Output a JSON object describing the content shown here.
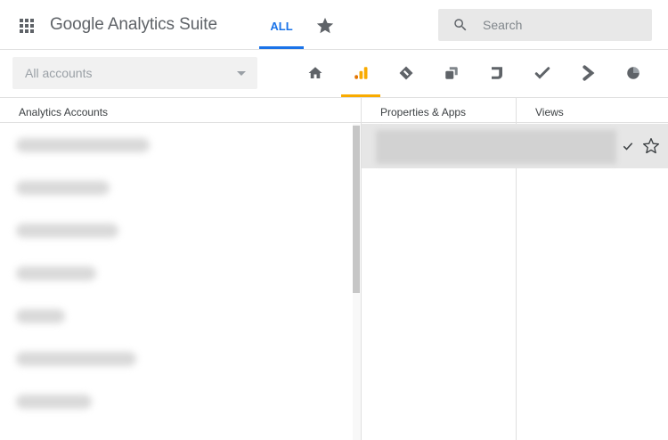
{
  "header": {
    "apps_icon": "apps-grid-icon",
    "brand_google": "Google",
    "brand_product": "Analytics Suite",
    "tabs": [
      {
        "label": "ALL",
        "active": true
      },
      {
        "icon": "star-icon",
        "active": false
      }
    ],
    "search": {
      "placeholder": "Search",
      "value": "",
      "icon": "search-icon"
    },
    "accent_color": "#1a73e8"
  },
  "toolbar": {
    "account_selector": {
      "value": "All accounts",
      "icon": "dropdown-caret-icon"
    },
    "product_tabs": [
      {
        "name": "home",
        "icon": "home-icon",
        "active": false
      },
      {
        "name": "analytics",
        "icon": "analytics-bars-icon",
        "active": true
      },
      {
        "name": "tag-manager",
        "icon": "tag-manager-icon",
        "active": false
      },
      {
        "name": "optimize",
        "icon": "optimize-icon",
        "active": false
      },
      {
        "name": "data-studio",
        "icon": "data-studio-icon",
        "active": false
      },
      {
        "name": "surveys",
        "icon": "surveys-check-icon",
        "active": false
      },
      {
        "name": "attribution",
        "icon": "attribution-chevron-icon",
        "active": false
      },
      {
        "name": "audience-center",
        "icon": "audience-pie-icon",
        "active": false
      }
    ],
    "active_color": "#f9ab00"
  },
  "columns": {
    "accounts": {
      "header": "Analytics Accounts"
    },
    "properties": {
      "header": "Properties & Apps"
    },
    "views": {
      "header": "Views"
    }
  },
  "accounts_list": {
    "rows_blurred": true
  },
  "selected_row": {
    "blurred": true,
    "check_icon": "checkmark-icon",
    "star_icon": "star-outline-icon"
  }
}
